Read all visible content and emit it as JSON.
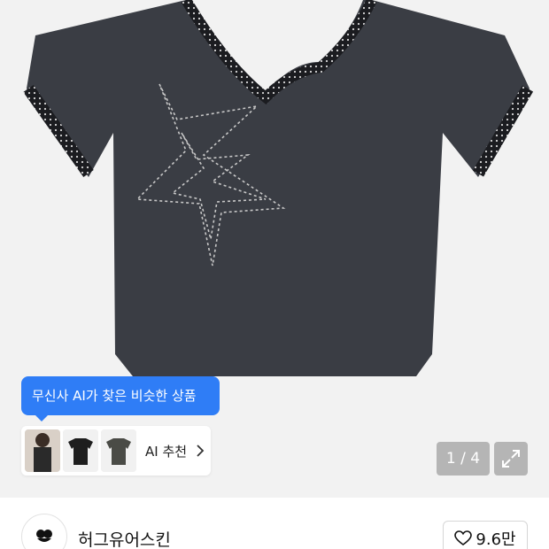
{
  "gallery": {
    "ai_tooltip": "무신사 AI가 찾은 비슷한 상품",
    "ai_recommend_label": "AI 추천",
    "current_image": 1,
    "total_images": 4,
    "counter_text": "1 / 4",
    "icons": [
      "chevron-right-icon",
      "expand-icon"
    ]
  },
  "brand": {
    "name": "허그유어스킨",
    "like_count": "9.6만"
  },
  "colors": {
    "tooltip_bg": "#2f7df6",
    "gallery_bg": "#f2f2f2",
    "shirt": "#3a3d44"
  }
}
